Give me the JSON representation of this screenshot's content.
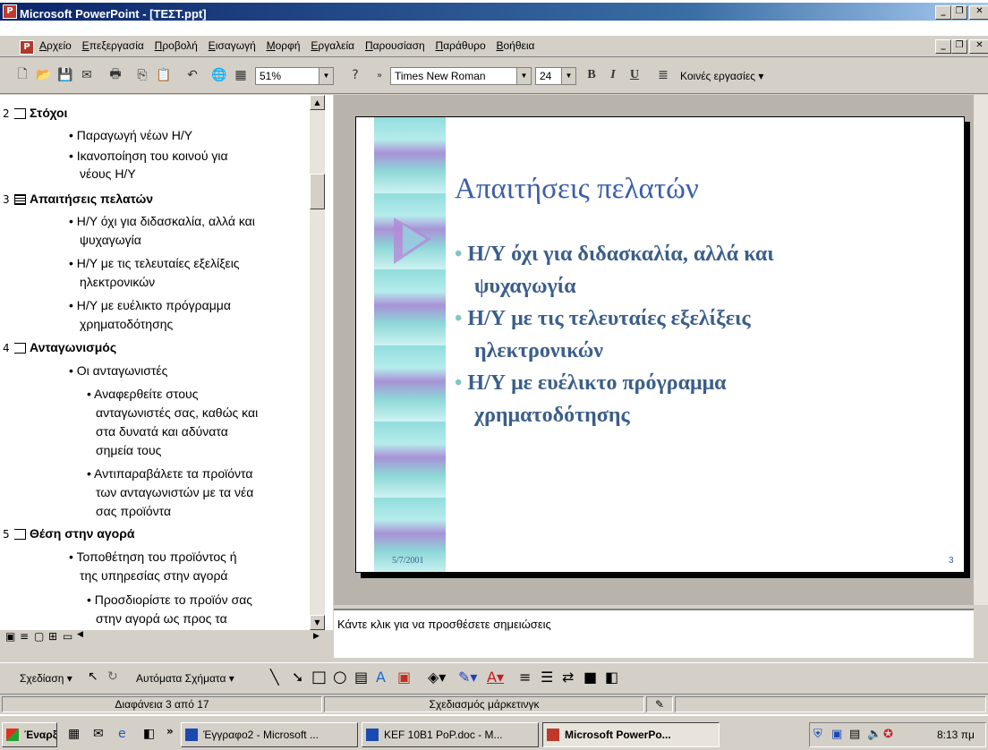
{
  "window": {
    "title": "Microsoft PowerPoint - [ΤΕΣΤ.ppt]"
  },
  "menu": [
    "Αρχείο",
    "Επεξεργασία",
    "Προβολή",
    "Εισαγωγή",
    "Μορφή",
    "Εργαλεία",
    "Παρουσίαση",
    "Παράθυρο",
    "Βοήθεια"
  ],
  "toolbar": {
    "zoom": "51%",
    "font": "Times New Roman",
    "size": "24",
    "bold": "B",
    "italic": "I",
    "underline": "U",
    "tasks": "Κοινές εργασίες ▾"
  },
  "outline": {
    "s2": {
      "num": "2",
      "title": "Στόχοι",
      "b1": "Παραγωγή νέων Η/Υ",
      "b2a": "Ικανοποίηση του κοινού για",
      "b2b": "νέους Η/Υ"
    },
    "s3": {
      "num": "3",
      "title": "Απαιτήσεις πελατών",
      "b1a": "Η/Υ όχι για διδασκαλία, αλλά και",
      "b1b": "ψυχαγωγία",
      "b2a": "Η/Υ με τις τελευταίες εξελίξεις",
      "b2b": "ηλεκτρονικών",
      "b3a": "Η/Υ με ευέλικτο πρόγραμμα",
      "b3b": "χρηματοδότησης"
    },
    "s4": {
      "num": "4",
      "title": "Ανταγωνισμός",
      "b1": "Οι ανταγωνιστές",
      "c1a": "Αναφερθείτε στους",
      "c1b": "ανταγωνιστές σας, καθώς και",
      "c1c": "στα δυνατά και αδύνατα",
      "c1d": "σημεία τους",
      "c2a": "Αντιπαραβάλετε τα προϊόντα",
      "c2b": "των ανταγωνιστών με τα νέα",
      "c2c": "σας προϊόντα"
    },
    "s5": {
      "num": "5",
      "title": "Θέση στην αγορά",
      "b1a": "Τοποθέτηση του προϊόντος ή",
      "b1b": "της υπηρεσίας στην αγορά",
      "c1a": "Προσδιορίστε το προϊόν σας",
      "c1b": "στην αγορά ως προς τα"
    }
  },
  "slide": {
    "title": "Απαιτήσεις πελατών",
    "b1a": "Η/Υ όχι για διδασκαλία, αλλά και",
    "b1b": "ψυχαγωγία",
    "b2a": "Η/Υ με τις τελευταίες εξελίξεις",
    "b2b": "ηλεκτρονικών",
    "b3a": "Η/Υ με ευέλικτο πρόγραμμα",
    "b3b": "χρηματοδότησης",
    "date": "5/7/2001",
    "number": "3"
  },
  "notes": {
    "placeholder": "Κάντε κλικ για να προσθέσετε σημειώσεις"
  },
  "drawbar": {
    "draw": "Σχεδίαση ▾",
    "autoshapes": "Αυτόματα Σχήματα ▾"
  },
  "status": {
    "slide": "Διαφάνεια 3 από 17",
    "design": "Σχεδιασμός μάρκετινγκ"
  },
  "taskbar": {
    "start": "Έναρξη",
    "t1": "Έγγραφο2 - Microsoft ...",
    "t2": "KEF 10B1 PoP.doc - M...",
    "t3": "Microsoft PowerPo...",
    "clock": "8:13 πμ"
  },
  "colors": {
    "titlebar": "#0a246a",
    "slideTitle": "#3b5ea8",
    "slideBody": "#3b5e8a"
  }
}
